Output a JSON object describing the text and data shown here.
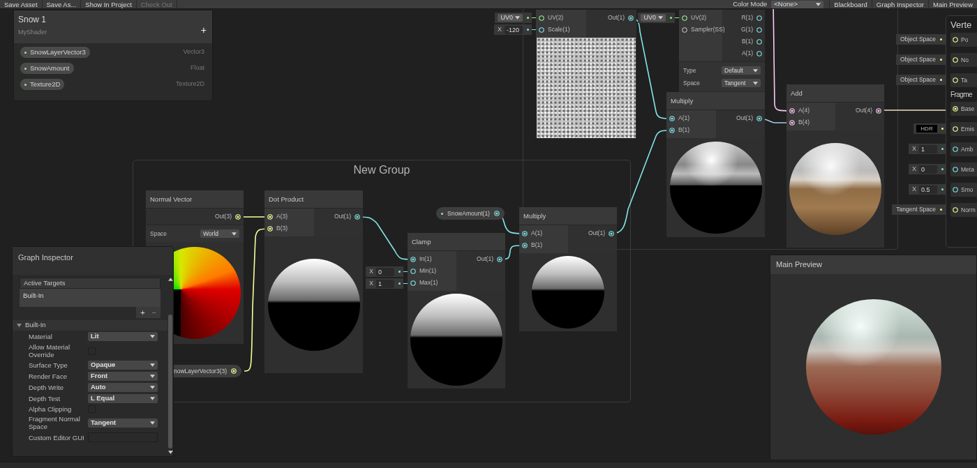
{
  "toolbar": {
    "buttons": [
      {
        "label": "Save Asset",
        "disabled": false
      },
      {
        "label": "Save As...",
        "disabled": false
      },
      {
        "label": "Show In Project",
        "disabled": false
      },
      {
        "label": "Check Out",
        "disabled": true
      }
    ],
    "color_mode": {
      "label": "Color Mode",
      "value": "<None>"
    },
    "panel_buttons": [
      "Blackboard",
      "Graph Inspector",
      "Main Preview"
    ]
  },
  "blackboard": {
    "title": "Snow 1",
    "subtitle": "MyShader",
    "add": "+",
    "properties": [
      {
        "name": "SnowLayerVector3",
        "type": "Vector3"
      },
      {
        "name": "SnowAmount",
        "type": "Float"
      },
      {
        "name": "Texture2D",
        "type": "Texture2D"
      }
    ]
  },
  "groups": [
    {
      "title": "New Group"
    }
  ],
  "nodes": [
    {
      "inputs": [
        {
          "label": "UV(2)",
          "kind": "vector2",
          "connected": false,
          "field": {
            "kind": "dropdown",
            "value": "UV0"
          }
        },
        {
          "label": "Scale(1)",
          "kind": "vector1",
          "connected": false,
          "field": {
            "kind": "number",
            "axis": "X",
            "value": "-120"
          }
        }
      ],
      "outputs": [
        {
          "label": "Out(1)",
          "kind": "vector1",
          "connected": true
        }
      ],
      "preview": {
        "kind": "noise"
      }
    },
    {
      "inputs": [
        {
          "label": "UV(2)",
          "kind": "vector2",
          "connected": false,
          "field": {
            "kind": "dropdown",
            "value": "UV0"
          }
        },
        {
          "label": "Sampler(SS)",
          "kind": "sampler",
          "connected": false
        }
      ],
      "outputs": [
        {
          "label": "R(1)",
          "kind": "vector1",
          "connected": false
        },
        {
          "label": "G(1)",
          "kind": "vector1",
          "connected": false
        },
        {
          "label": "B(1)",
          "kind": "vector1",
          "connected": false
        },
        {
          "label": "A(1)",
          "kind": "vector1",
          "connected": false
        }
      ],
      "settings": [
        {
          "label": "Type",
          "value": "Default"
        },
        {
          "label": "Space",
          "value": "Tangent"
        }
      ],
      "expander": true
    },
    {
      "title": "Multiply",
      "inputs": [
        {
          "label": "A(1)",
          "kind": "vector1",
          "connected": true
        },
        {
          "label": "B(1)",
          "kind": "vector1",
          "connected": true
        }
      ],
      "outputs": [
        {
          "label": "Out(1)",
          "kind": "vector1",
          "connected": true
        }
      ],
      "preview": {
        "kind": "snow"
      }
    },
    {
      "title": "Add",
      "inputs": [
        {
          "label": "A(4)",
          "kind": "vector4",
          "connected": true
        },
        {
          "label": "B(4)",
          "kind": "vector4",
          "connected": true
        }
      ],
      "outputs": [
        {
          "label": "Out(4)",
          "kind": "vector4",
          "connected": true
        }
      ],
      "preview": {
        "kind": "snow_wood"
      }
    },
    {
      "title": "Normal Vector",
      "outputs": [
        {
          "label": "Out(3)",
          "kind": "vector3",
          "connected": true
        }
      ],
      "settings": [
        {
          "label": "Space",
          "value": "World"
        }
      ],
      "preview": {
        "kind": "normal"
      }
    },
    {
      "title": "Dot Product",
      "inputs": [
        {
          "label": "A(3)",
          "kind": "vector3",
          "connected": true
        },
        {
          "label": "B(3)",
          "kind": "vector3",
          "connected": true
        }
      ],
      "outputs": [
        {
          "label": "Out(1)",
          "kind": "vector1",
          "connected": true
        }
      ],
      "preview": {
        "kind": "gradient"
      }
    },
    {
      "title": "Clamp",
      "inputs": [
        {
          "label": "In(1)",
          "kind": "vector1",
          "connected": true
        },
        {
          "label": "Min(1)",
          "kind": "vector1",
          "connected": false,
          "field": {
            "kind": "number",
            "axis": "X",
            "value": "0"
          }
        },
        {
          "label": "Max(1)",
          "kind": "vector1",
          "connected": false,
          "field": {
            "kind": "number",
            "axis": "X",
            "value": "1"
          }
        }
      ],
      "outputs": [
        {
          "label": "Out(1)",
          "kind": "vector1",
          "connected": true
        }
      ],
      "preview": {
        "kind": "gradient"
      }
    },
    {
      "title": "Multiply",
      "inputs": [
        {
          "label": "A(1)",
          "kind": "vector1",
          "connected": true
        },
        {
          "label": "B(1)",
          "kind": "vector1",
          "connected": true
        }
      ],
      "outputs": [
        {
          "label": "Out(1)",
          "kind": "vector1",
          "connected": true
        }
      ],
      "preview": {
        "kind": "gradient"
      }
    }
  ],
  "property_nodes": [
    {
      "label": "SnowAmount(1)",
      "kind": "vector1"
    },
    {
      "label": "nowLayerVector3(3)",
      "kind": "vector3"
    }
  ],
  "master_stack": {
    "vertex": {
      "title": "Verte",
      "ports": [
        {
          "label": "Po",
          "kind": "vector3",
          "connected": false,
          "field": {
            "kind": "label",
            "value": "Object Space"
          }
        },
        {
          "label": "No",
          "kind": "vector3",
          "connected": false,
          "field": {
            "kind": "label",
            "value": "Object Space"
          }
        },
        {
          "label": "Ta",
          "kind": "vector3",
          "connected": false,
          "field": {
            "kind": "label",
            "value": "Object Space"
          }
        }
      ]
    },
    "fragment": {
      "title": "Fragme",
      "ports": [
        {
          "label": "Base",
          "kind": "vector3",
          "connected": true
        },
        {
          "label": "Emis",
          "kind": "vector3",
          "connected": false,
          "field": {
            "kind": "hdr",
            "value": "HDR"
          }
        },
        {
          "label": "Amb",
          "kind": "vector1",
          "connected": false,
          "field": {
            "kind": "number",
            "axis": "X",
            "value": "1"
          }
        },
        {
          "label": "Meta",
          "kind": "vector1",
          "connected": false,
          "field": {
            "kind": "number",
            "axis": "X",
            "value": "0"
          }
        },
        {
          "label": "Smo",
          "kind": "vector1",
          "connected": false,
          "field": {
            "kind": "number",
            "axis": "X",
            "value": "0.5"
          }
        },
        {
          "label": "Norm",
          "kind": "vector3",
          "connected": false,
          "field": {
            "kind": "label",
            "value": "Tangent Space"
          }
        }
      ]
    }
  },
  "main_preview": {
    "title": "Main Preview"
  },
  "graph_inspector": {
    "title": "Graph Inspector",
    "targets": {
      "title": "Active Targets",
      "items": [
        "Built-In"
      ],
      "add": "+",
      "remove": "−"
    },
    "section": {
      "title": "Built-In",
      "expanded": true,
      "fields": [
        {
          "label": "Material",
          "kind": "dropdown",
          "value": "Lit"
        },
        {
          "label": "Allow Material Override",
          "kind": "checkbox",
          "checked": false
        },
        {
          "label": "Surface Type",
          "kind": "dropdown",
          "value": "Opaque"
        },
        {
          "label": "Render Face",
          "kind": "dropdown",
          "value": "Front"
        },
        {
          "label": "Depth Write",
          "kind": "dropdown",
          "value": "Auto"
        },
        {
          "label": "Depth Test",
          "kind": "dropdown",
          "value": "L Equal"
        },
        {
          "label": "Alpha Clipping",
          "kind": "checkbox",
          "checked": false
        },
        {
          "label": "Fragment Normal Space",
          "kind": "dropdown",
          "value": "Tangent"
        },
        {
          "label": "Custom Editor GUI",
          "kind": "text"
        }
      ]
    }
  }
}
